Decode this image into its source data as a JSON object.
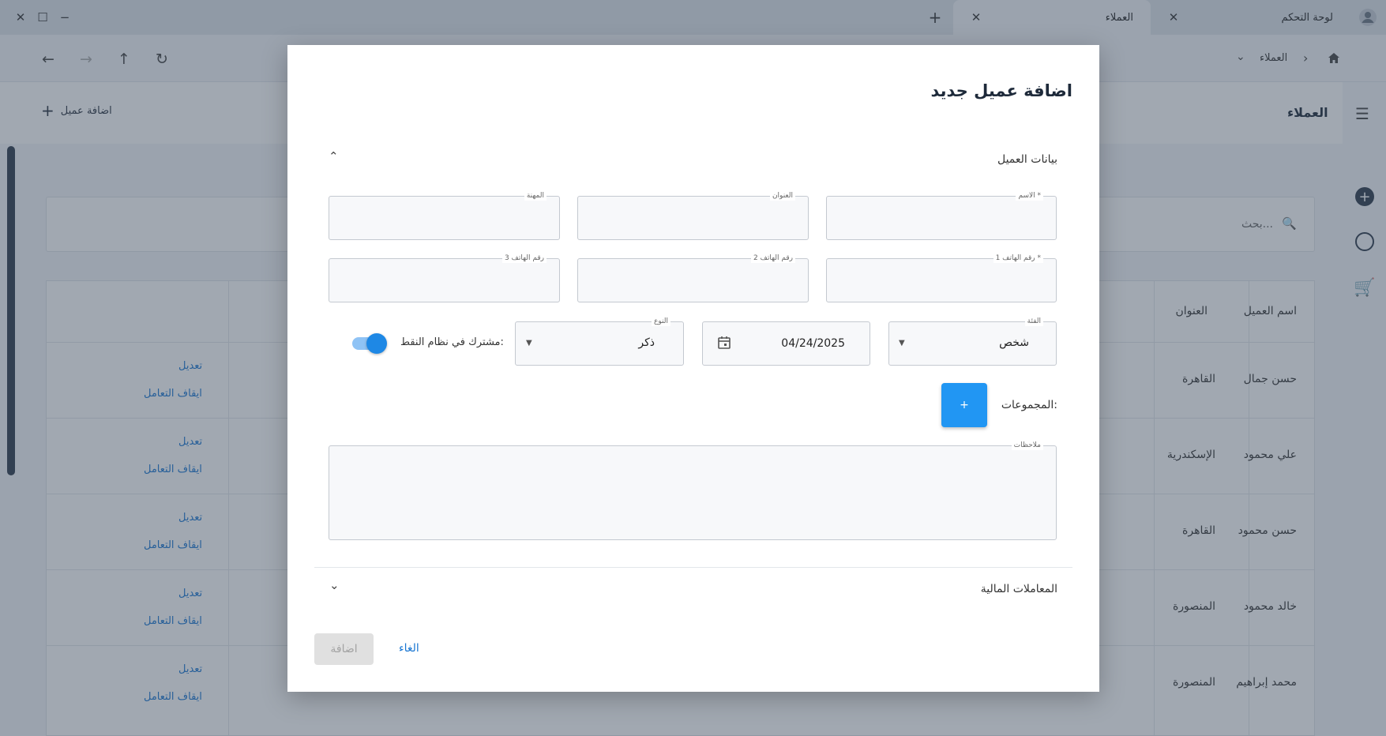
{
  "titlebar": {
    "tabs": [
      {
        "label": "لوحة التحكم"
      },
      {
        "label": "العملاء"
      }
    ],
    "new_tab_icon": "plus-icon",
    "window_controls": [
      "close-icon",
      "maximize-icon",
      "minimize-icon"
    ]
  },
  "toolbar": {
    "breadcrumb": {
      "home_icon": "home-icon",
      "current": "العملاء"
    }
  },
  "page": {
    "title": "العملاء",
    "add_button_label": "اضافة عميل",
    "search_placeholder": "بحث...",
    "columns": [
      "اسم العميل",
      "العنوان"
    ],
    "rows": [
      {
        "name": "حسن جمال",
        "address": "القاهرة"
      },
      {
        "name": "علي محمود",
        "address": "الإسكندرية"
      },
      {
        "name": "حسن محمود",
        "address": "القاهرة"
      },
      {
        "name": "خالد محمود",
        "address": "المنصورة"
      },
      {
        "name": "محمد إبراهيم",
        "address": "المنصورة"
      }
    ],
    "row_actions": {
      "edit": "تعديل",
      "stop": "ايقاف التعامل"
    }
  },
  "dialog": {
    "title": "اضافة عميل جديد",
    "section_customer": "بيانات العميل",
    "section_financial": "المعاملات المالية",
    "fields": {
      "name": {
        "label": "الاسم *",
        "value": ""
      },
      "address": {
        "label": "العنوان",
        "value": ""
      },
      "profession": {
        "label": "المهنة",
        "value": ""
      },
      "phone1": {
        "label": "رقم الهاتف 1 *",
        "value": ""
      },
      "phone2": {
        "label": "رقم الهاتف 2",
        "value": ""
      },
      "phone3": {
        "label": "رقم الهاتف 3",
        "value": ""
      },
      "category": {
        "label": "الفئة",
        "value": "شخص"
      },
      "date": {
        "value": "04/24/2025"
      },
      "gender": {
        "label": "النوع",
        "value": "ذكر"
      },
      "points": {
        "label": "مشترك في نظام النقط:",
        "enabled": true
      },
      "groups": {
        "label": "المجموعات:",
        "add_label": "+"
      },
      "notes": {
        "label": "ملاحظات",
        "value": ""
      }
    },
    "buttons": {
      "submit": "اضافة",
      "cancel": "الغاء"
    }
  }
}
